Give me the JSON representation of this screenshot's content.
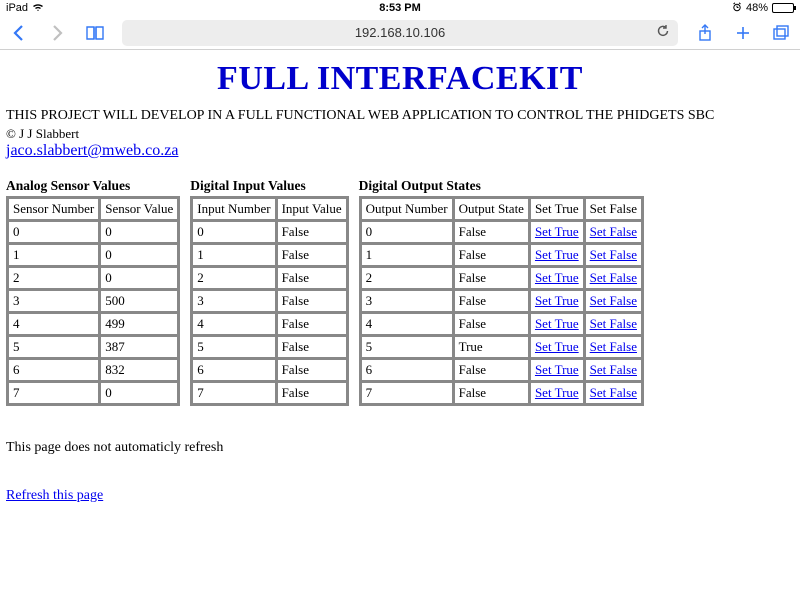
{
  "status": {
    "device": "iPad",
    "time": "8:53 PM",
    "alarm_icon": "alarm",
    "battery_pct": "48%",
    "battery_fill_pct": 48
  },
  "toolbar": {
    "url": "192.168.10.106"
  },
  "page": {
    "title": "FULL INTERFACEKIT",
    "intro": "THIS PROJECT WILL DEVELOP IN A FULL FUNCTIONAL WEB APPLICATION TO CONTROL THE PHIDGETS SBC",
    "copyright": "© J J Slabbert",
    "email": "jaco.slabbert@mweb.co.za",
    "footer_note": "This page does not automaticly refresh",
    "refresh_label": "Refresh this page"
  },
  "analog": {
    "title": "Analog Sensor Values",
    "col1": "Sensor Number",
    "col2": "Sensor Value",
    "rows": [
      {
        "n": "0",
        "v": "0"
      },
      {
        "n": "1",
        "v": "0"
      },
      {
        "n": "2",
        "v": "0"
      },
      {
        "n": "3",
        "v": "500"
      },
      {
        "n": "4",
        "v": "499"
      },
      {
        "n": "5",
        "v": "387"
      },
      {
        "n": "6",
        "v": "832"
      },
      {
        "n": "7",
        "v": "0"
      }
    ]
  },
  "digital_in": {
    "title": "Digital Input Values",
    "col1": "Input Number",
    "col2": "Input Value",
    "rows": [
      {
        "n": "0",
        "v": "False"
      },
      {
        "n": "1",
        "v": "False"
      },
      {
        "n": "2",
        "v": "False"
      },
      {
        "n": "3",
        "v": "False"
      },
      {
        "n": "4",
        "v": "False"
      },
      {
        "n": "5",
        "v": "False"
      },
      {
        "n": "6",
        "v": "False"
      },
      {
        "n": "7",
        "v": "False"
      }
    ]
  },
  "digital_out": {
    "title": "Digital Output States",
    "col1": "Output Number",
    "col2": "Output State",
    "col3": "Set True",
    "col4": "Set False",
    "set_true_label": "Set True",
    "set_false_label": "Set False",
    "rows": [
      {
        "n": "0",
        "v": "False"
      },
      {
        "n": "1",
        "v": "False"
      },
      {
        "n": "2",
        "v": "False"
      },
      {
        "n": "3",
        "v": "False"
      },
      {
        "n": "4",
        "v": "False"
      },
      {
        "n": "5",
        "v": "True"
      },
      {
        "n": "6",
        "v": "False"
      },
      {
        "n": "7",
        "v": "False"
      }
    ]
  }
}
